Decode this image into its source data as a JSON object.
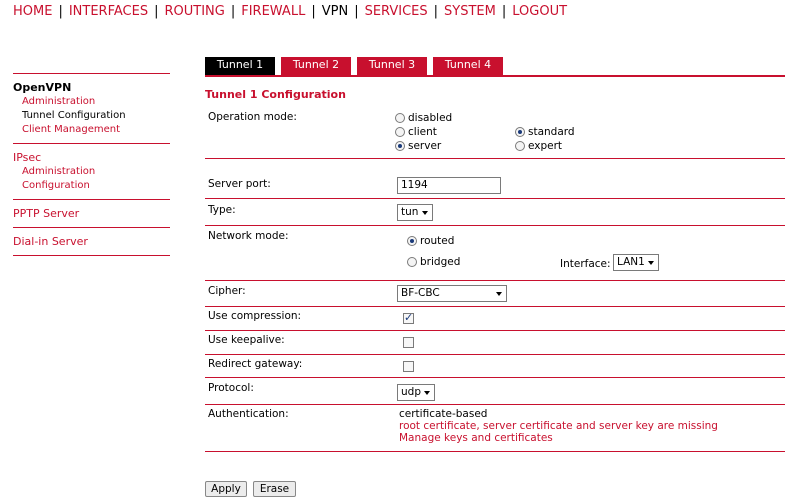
{
  "nav": {
    "items": [
      "HOME",
      "INTERFACES",
      "ROUTING",
      "FIREWALL",
      "VPN",
      "SERVICES",
      "SYSTEM",
      "LOGOUT"
    ],
    "active": "VPN"
  },
  "sidebar": {
    "openvpn": {
      "title": "OpenVPN",
      "items": [
        "Administration",
        "Tunnel Configuration",
        "Client Management"
      ]
    },
    "ipsec": {
      "title": "IPsec",
      "items": [
        "Administration",
        "Configuration"
      ]
    },
    "pptp": "PPTP Server",
    "dialin": "Dial-in Server"
  },
  "tabs": [
    "Tunnel 1",
    "Tunnel 2",
    "Tunnel 3",
    "Tunnel 4"
  ],
  "title": "Tunnel 1 Configuration",
  "form": {
    "operation_mode": {
      "label": "Operation mode:",
      "options": {
        "disabled": "disabled",
        "client": "client",
        "server": "server"
      },
      "selected": "server",
      "sub_options": {
        "standard": "standard",
        "expert": "expert"
      },
      "sub_selected": "standard"
    },
    "server_port": {
      "label": "Server port:",
      "value": "1194"
    },
    "type": {
      "label": "Type:",
      "value": "tun"
    },
    "network_mode": {
      "label": "Network mode:",
      "routed": "routed",
      "bridged": "bridged",
      "selected": "routed",
      "interface_label": "Interface:",
      "interface_value": "LAN1"
    },
    "cipher": {
      "label": "Cipher:",
      "value": "BF-CBC"
    },
    "use_compression": {
      "label": "Use compression:",
      "checked": true
    },
    "use_keepalive": {
      "label": "Use keepalive:",
      "checked": false
    },
    "redirect_gateway": {
      "label": "Redirect gateway:",
      "checked": false
    },
    "protocol": {
      "label": "Protocol:",
      "value": "udp"
    },
    "authentication": {
      "label": "Authentication:",
      "value": "certificate-based",
      "warning": "root certificate, server certificate and server key are missing",
      "link": "Manage keys and certificates"
    }
  },
  "buttons": {
    "apply": "Apply",
    "erase": "Erase"
  },
  "colors": {
    "accent": "#c8102e",
    "active_tab": "#000000"
  }
}
